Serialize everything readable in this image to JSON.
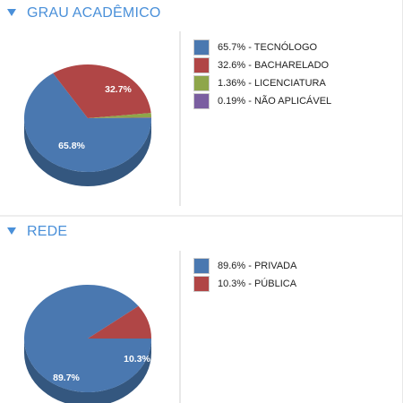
{
  "panels": [
    {
      "title": "GRAU ACADÊMICO",
      "colors": [
        "#4a78b0",
        "#b04646",
        "#8ea64a",
        "#7a5ea0"
      ],
      "shades": [
        "#34577f",
        "#7f3232",
        "#66783a",
        "#584476"
      ],
      "legend": [
        "65.7% - TECNÓLOGO",
        "32.6% - BACHARELADO",
        "1.36% - LICENCIATURA",
        "0.19% - NÃO APLICÁVEL"
      ],
      "pie_labels": [
        "65.8%",
        "32.7%"
      ]
    },
    {
      "title": "REDE",
      "colors": [
        "#4a78b0",
        "#b04646"
      ],
      "shades": [
        "#34577f",
        "#7f3232"
      ],
      "legend": [
        "89.6% - PRIVADA",
        "10.3% - PÚBLICA"
      ],
      "pie_labels": [
        "89.7%",
        "10.3%"
      ]
    }
  ],
  "chart_data": [
    {
      "type": "pie",
      "title": "GRAU ACADÊMICO",
      "categories": [
        "TECNÓLOGO",
        "BACHARELADO",
        "LICENCIATURA",
        "NÃO APLICÁVEL"
      ],
      "values": [
        65.7,
        32.6,
        1.36,
        0.19
      ],
      "legend_position": "right"
    },
    {
      "type": "pie",
      "title": "REDE",
      "categories": [
        "PRIVADA",
        "PÚBLICA"
      ],
      "values": [
        89.6,
        10.3
      ],
      "legend_position": "right"
    }
  ]
}
